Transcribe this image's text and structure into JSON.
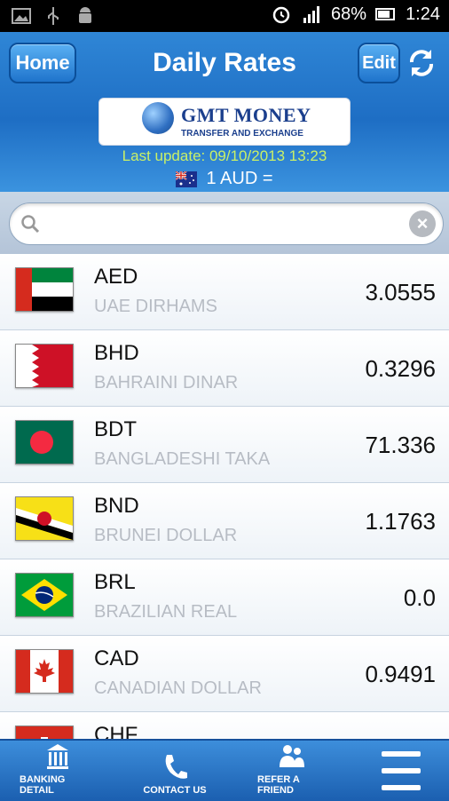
{
  "status_bar": {
    "battery_percent": "68%",
    "time": "1:24",
    "left_icons": [
      "image-icon",
      "usb-icon",
      "android-icon"
    ]
  },
  "header": {
    "home_label": "Home",
    "title": "Daily Rates",
    "edit_label": "Edit"
  },
  "logo": {
    "brand": "GMT MONEY",
    "tagline": "TRANSFER AND EXCHANGE"
  },
  "last_update": "Last update: 09/10/2013 13:23",
  "base_currency": "1 AUD =",
  "search": {
    "value": "",
    "placeholder": ""
  },
  "rates": [
    {
      "code": "AED",
      "name": "UAE DIRHAMS",
      "rate": "3.0555"
    },
    {
      "code": "BHD",
      "name": "BAHRAINI DINAR",
      "rate": "0.3296"
    },
    {
      "code": "BDT",
      "name": "BANGLADESHI TAKA",
      "rate": "71.336"
    },
    {
      "code": "BND",
      "name": "BRUNEI DOLLAR",
      "rate": "1.1763"
    },
    {
      "code": "BRL",
      "name": "BRAZILIAN REAL",
      "rate": "0.0"
    },
    {
      "code": "CAD",
      "name": "CANADIAN DOLLAR",
      "rate": "0.9491"
    },
    {
      "code": "CHF",
      "name": "",
      "rate": ""
    }
  ],
  "bottom_nav": {
    "banking_label": "BANKING DETAIL",
    "contact_label": "CONTACT US",
    "refer_label": "REFER A FRIEND"
  },
  "colors": {
    "header_blue": "#1e6ec4",
    "update_green": "#c9f067",
    "nav_blue": "#1b5fb0"
  }
}
